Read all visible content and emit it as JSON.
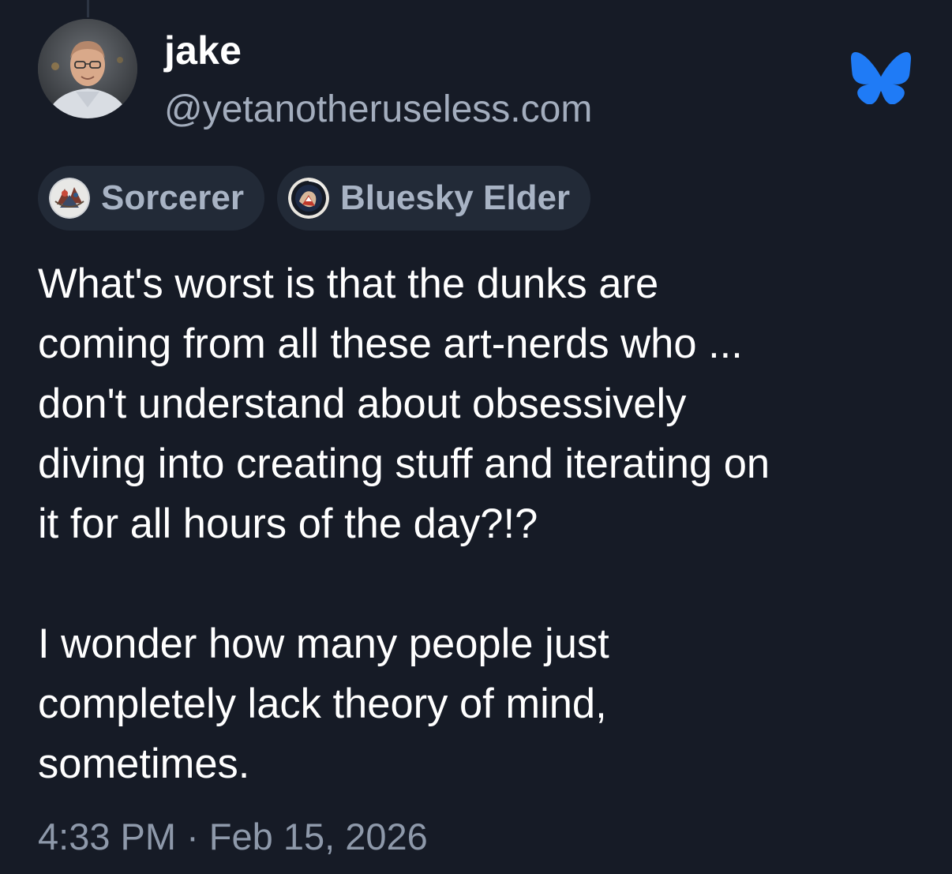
{
  "author": {
    "display_name": "jake",
    "handle": "@yetanotheruseless.com",
    "avatar_icon": "user-photo-avatar"
  },
  "app_logo": {
    "icon": "bluesky-butterfly-icon",
    "color": "#1f7bf6"
  },
  "badges": [
    {
      "label": "Sorcerer",
      "icon": "sorcerer-badge-icon"
    },
    {
      "label": "Bluesky Elder",
      "icon": "elder-badge-icon"
    }
  ],
  "post": {
    "paragraphs": [
      {
        "lines": [
          "What's worst is that the dunks are",
          "coming from all these art-nerds who ...",
          "don't understand about obsessively",
          "diving into creating stuff and iterating on",
          "it for all hours of the day?!?"
        ]
      },
      {
        "lines": [
          "I wonder how many people just",
          "completely lack theory of mind,",
          "sometimes."
        ]
      }
    ],
    "timestamp": "4:33 PM · Feb 15, 2026"
  },
  "colors": {
    "background": "#161b26",
    "text_primary": "#ffffff",
    "text_secondary": "#a3adbd",
    "badge_bg": "#222a37",
    "brand_blue": "#1f7bf6"
  }
}
